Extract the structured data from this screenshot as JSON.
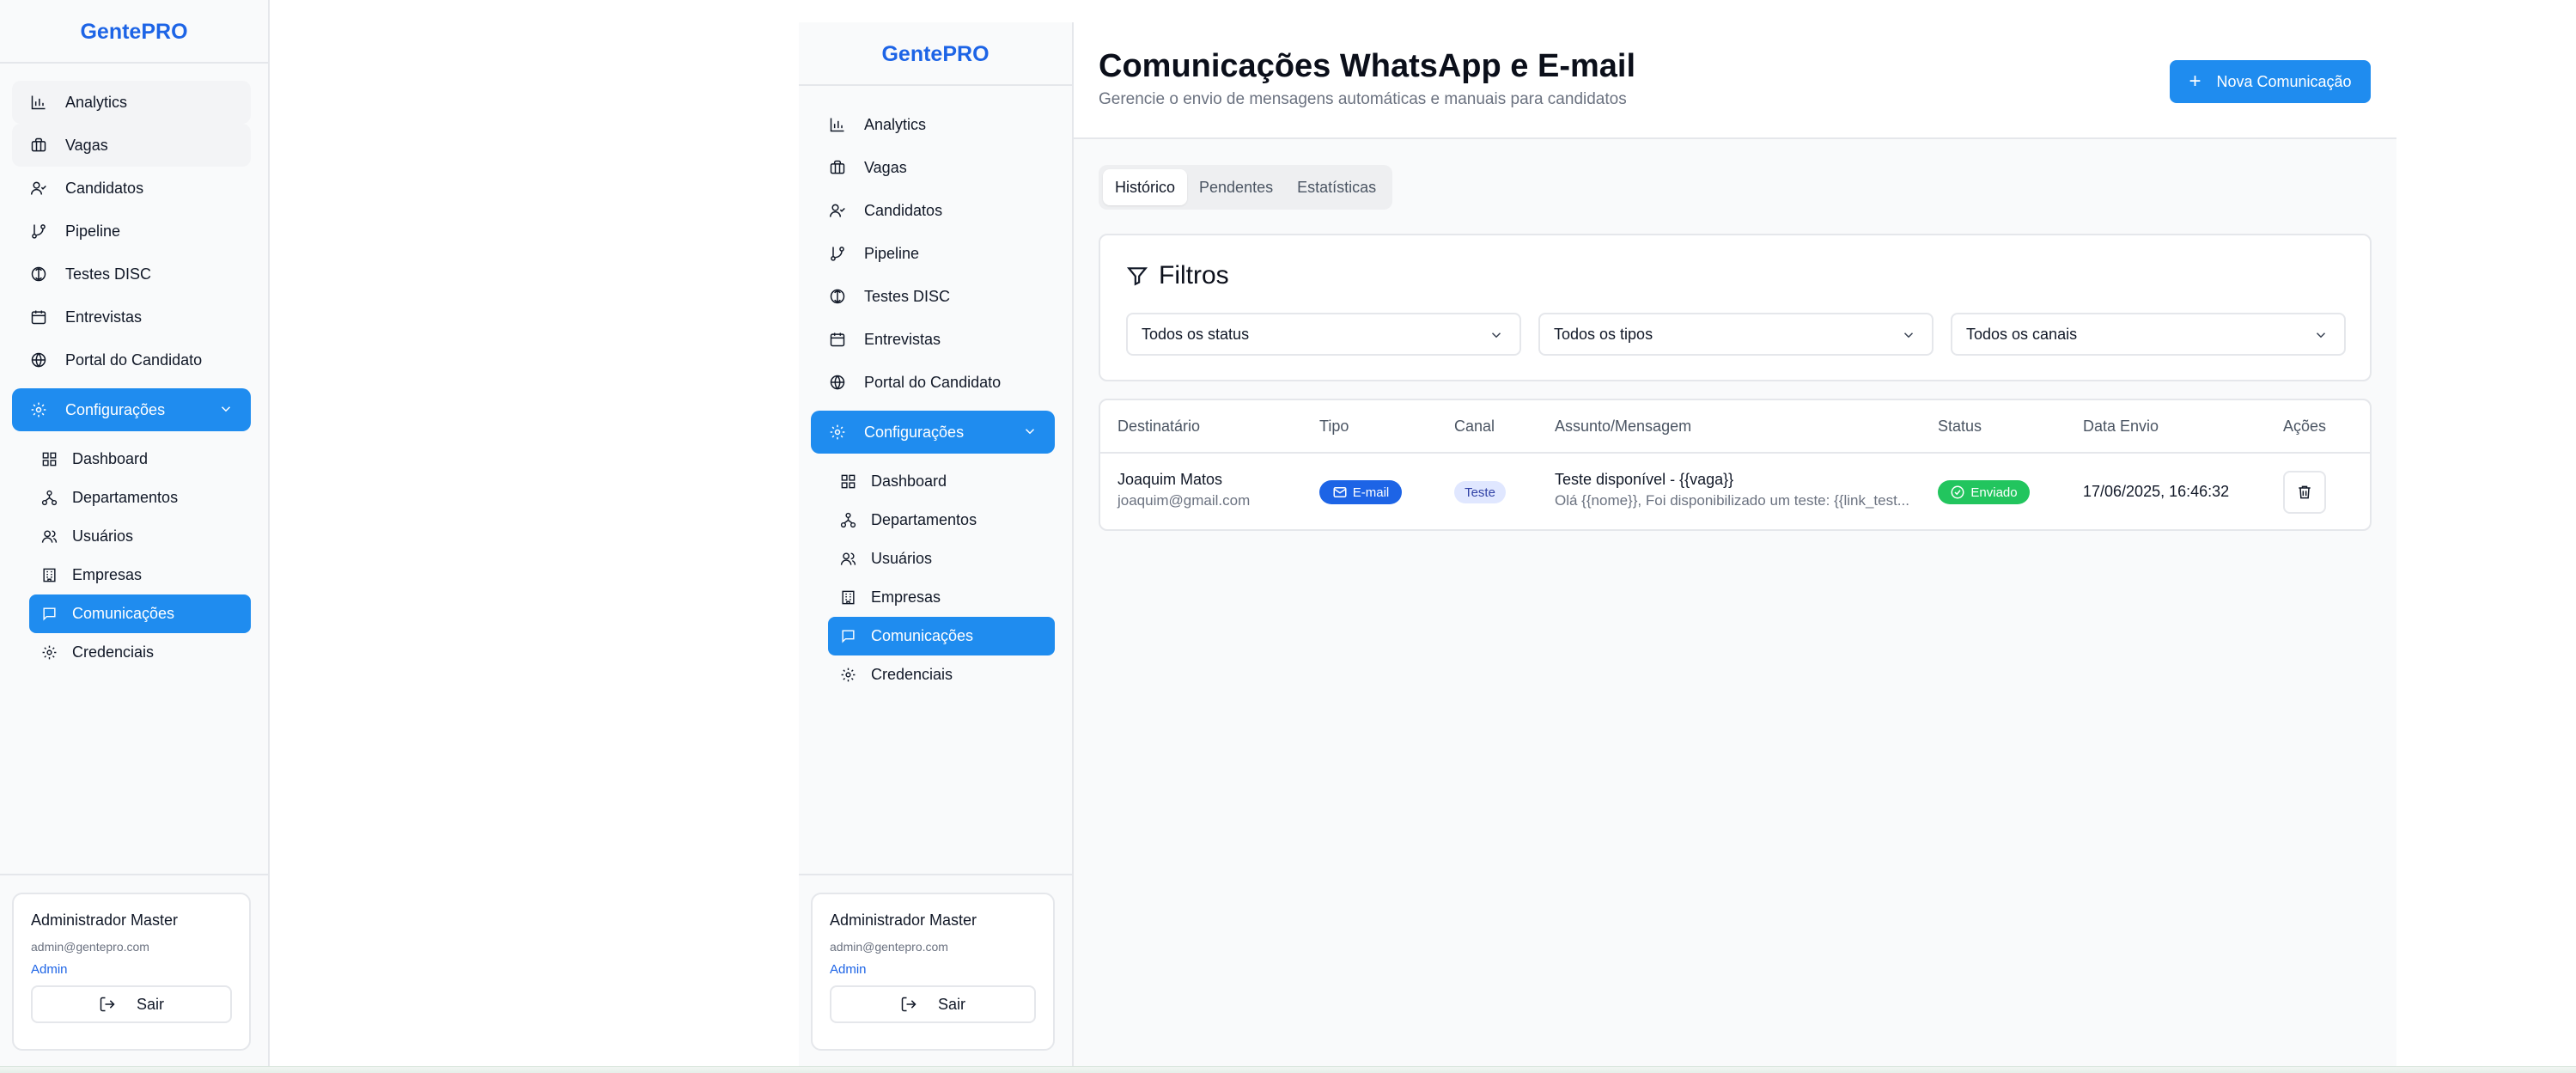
{
  "brand": "GentePRO",
  "nav": {
    "items": [
      {
        "label": "Analytics",
        "icon": "bar-chart-icon"
      },
      {
        "label": "Vagas",
        "icon": "briefcase-icon"
      },
      {
        "label": "Candidatos",
        "icon": "user-check-icon"
      },
      {
        "label": "Pipeline",
        "icon": "git-branch-icon"
      },
      {
        "label": "Testes DISC",
        "icon": "disc-icon"
      },
      {
        "label": "Entrevistas",
        "icon": "calendar-icon"
      },
      {
        "label": "Portal do Candidato",
        "icon": "globe-icon"
      }
    ],
    "config_label": "Configurações",
    "sub_items": [
      {
        "label": "Dashboard",
        "icon": "layout-grid-icon"
      },
      {
        "label": "Departamentos",
        "icon": "network-icon"
      },
      {
        "label": "Usuários",
        "icon": "users-icon"
      },
      {
        "label": "Empresas",
        "icon": "building-icon"
      },
      {
        "label": "Comunicações",
        "icon": "message-icon"
      },
      {
        "label": "Credenciais",
        "icon": "gear-icon"
      }
    ]
  },
  "user": {
    "name": "Administrador Master",
    "email": "admin@gentepro.com",
    "role": "Admin",
    "logout_label": "Sair"
  },
  "header": {
    "title": "Comunicações WhatsApp e E-mail",
    "subtitle": "Gerencie o envio de mensagens automáticas e manuais para candidatos",
    "new_button": "Nova Comunicação"
  },
  "tabs": [
    "Histórico",
    "Pendentes",
    "Estatísticas"
  ],
  "filters": {
    "title": "Filtros",
    "status": "Todos os status",
    "types": "Todos os tipos",
    "channels": "Todos os canais"
  },
  "table": {
    "columns": [
      "Destinatário",
      "Tipo",
      "Canal",
      "Assunto/Mensagem",
      "Status",
      "Data Envio",
      "Ações"
    ],
    "rows": [
      {
        "name": "Joaquim Matos",
        "email": "joaquim@gmail.com",
        "type": "E-mail",
        "channel": "Teste",
        "subject": "Teste disponível - {{vaga}}",
        "message": "Olá {{nome}}, Foi disponibilizado um teste: {{link_test...",
        "status": "Enviado",
        "date": "17/06/2025, 16:46:32"
      }
    ]
  },
  "colors": {
    "brand": "#1d64e6",
    "primary": "#1f8cef",
    "success": "#22c55e"
  }
}
